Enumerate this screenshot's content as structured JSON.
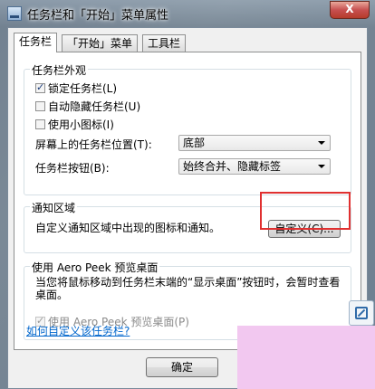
{
  "window": {
    "title": "任务栏和「开始」菜单属性",
    "close_label": "X"
  },
  "tabs": [
    {
      "label": "任务栏"
    },
    {
      "label": "「开始」菜单"
    },
    {
      "label": "工具栏"
    }
  ],
  "appearance": {
    "legend": "任务栏外观",
    "checkboxes": [
      {
        "label": "锁定任务栏(L)",
        "checked": true
      },
      {
        "label": "自动隐藏任务栏(U)",
        "checked": false
      },
      {
        "label": "使用小图标(I)",
        "checked": false
      }
    ],
    "location_label": "屏幕上的任务栏位置(T):",
    "location_value": "底部",
    "buttons_label": "任务栏按钮(B):",
    "buttons_value": "始终合并、隐藏标签"
  },
  "notification": {
    "legend": "通知区域",
    "description": "自定义通知区域中出现的图标和通知。",
    "customize_button": "自定义(C)..."
  },
  "aero_peek": {
    "legend": "使用 Aero Peek 预览桌面",
    "description": "当您将鼠标移动到任务栏末端的“显示桌面”按钮时，会暂时查看桌面。",
    "checkbox_label": "使用 Aero Peek 预览桌面(P)",
    "checked": true
  },
  "help_link": "如何自定义该任务栏?",
  "ok_button": "确定",
  "colors": {
    "highlight": "#e03030",
    "link": "#0066cc",
    "overlay_pink": "#f2c8f0"
  }
}
